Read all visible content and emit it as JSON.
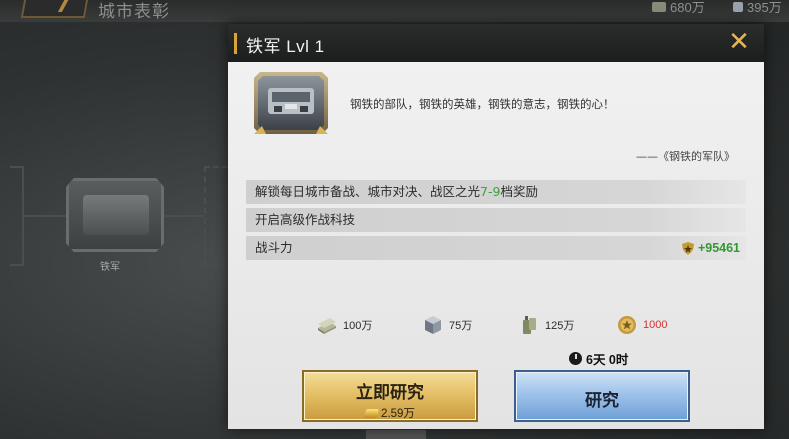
{
  "background": {
    "screen_title": "城市表彰",
    "resources": [
      {
        "icon": "cash-icon",
        "value": "680万"
      },
      {
        "icon": "steel-icon",
        "value": "395万"
      }
    ],
    "node_label": "铁军"
  },
  "dialog": {
    "title": "铁军 Lvl 1",
    "motto": "钢铁的部队，钢铁的英雄，钢铁的意志，钢铁的心！",
    "quote": "——《钢铁的军队》",
    "rows": {
      "row1_prefix": "解锁每日城市备战、城市对决、战区之光",
      "row1_highlight": "7-9",
      "row1_suffix": "档奖励",
      "row2": "开启高级作战科技",
      "row3_label": "战斗力",
      "row3_value": "+95461"
    },
    "costs": [
      {
        "icon": "cash-icon",
        "value": "100万"
      },
      {
        "icon": "steel-cube-icon",
        "value": "75万"
      },
      {
        "icon": "oil-icon",
        "value": "125万"
      },
      {
        "icon": "medal-icon",
        "value": "1000",
        "color": "#d23434"
      }
    ],
    "timer": "6天 0时",
    "instant_button": {
      "label": "立即研究",
      "cost": "2.59万"
    },
    "research_button": {
      "label": "研究"
    }
  },
  "colors": {
    "accent_gold": "#d9a33a",
    "highlight_green": "#3aa33a",
    "insufficient_red": "#d23434"
  }
}
